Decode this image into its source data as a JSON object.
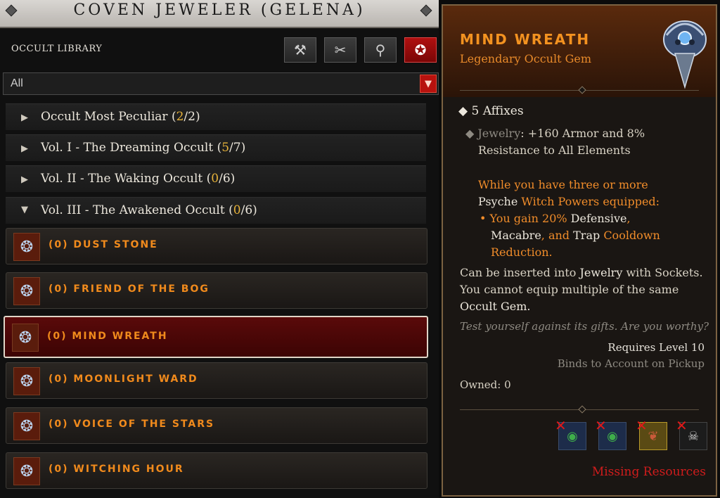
{
  "window": {
    "title": "COVEN JEWELER (GELENA)"
  },
  "library": {
    "label": "OCCULT LIBRARY",
    "tools": [
      {
        "icon": "hammer-icon",
        "glyph": "⚒"
      },
      {
        "icon": "tongs-icon",
        "glyph": "✂"
      },
      {
        "icon": "socket-ring-icon",
        "glyph": "⚲"
      },
      {
        "icon": "occult-gem-tab-icon",
        "glyph": "✪"
      }
    ],
    "filter": {
      "value": "All"
    }
  },
  "categories": [
    {
      "name": "Occult Most Peculiar",
      "open": "(",
      "count": "2",
      "slash": "/",
      "total": "2",
      "close": ")"
    },
    {
      "name": "Vol. I - The Dreaming Occult",
      "open": "(",
      "count": "5",
      "slash": "/",
      "total": "7",
      "close": ")"
    },
    {
      "name": "Vol. II - The Waking Occult",
      "open": "(",
      "count": "0",
      "slash": "/",
      "total": "6",
      "close": ")"
    },
    {
      "name": "Vol. III - The Awakened Occult",
      "open": "(",
      "count": "0",
      "slash": "/",
      "total": "6",
      "close": ")"
    }
  ],
  "gems": [
    {
      "label": "(0) DUST STONE"
    },
    {
      "label": "(0) FRIEND OF THE BOG"
    },
    {
      "label": "(0) MIND WREATH"
    },
    {
      "label": "(0) MOONLIGHT WARD"
    },
    {
      "label": "(0) VOICE OF THE STARS"
    },
    {
      "label": "(0) WITCHING HOUR"
    }
  ],
  "tooltip": {
    "name": "MIND WREATH",
    "type": "Legendary Occult Gem",
    "affixes": "5 Affixes",
    "jewelry_label": "Jewelry",
    "jewelry_stat_1": ": +160 Armor and 8%",
    "jewelry_stat_2": "Resistance to All Elements",
    "cond_1": "While you have three or more",
    "cond_2a": "Psyche ",
    "cond_2b": "Witch Powers equipped:",
    "eff_1a": "You gain 20% ",
    "eff_1b": "Defensive",
    "eff_1c": ",",
    "eff_2a": "Macabre",
    "eff_2b": ", and ",
    "eff_2c": "Trap ",
    "eff_2d": "Cooldown",
    "eff_3": "Reduction.",
    "ins_1a": "Can be inserted into ",
    "ins_1b": "Jewelry",
    "ins_1c": " with Sockets.",
    "ins_2": "You cannot equip multiple of the same",
    "ins_3": "Occult Gem.",
    "flavor": "Test yourself against its gifts. Are you worthy?",
    "requires": "Requires Level 10",
    "binds": "Binds to Account on Pickup",
    "owned": "Owned: 0",
    "materials": [
      {
        "icon": "green-gem-material-icon",
        "glyph": "◉",
        "color": "#3fae4a"
      },
      {
        "icon": "green-gem-material-icon",
        "glyph": "◉",
        "color": "#3fae4a"
      },
      {
        "icon": "heart-material-icon",
        "glyph": "❦",
        "color": "#c85a3a"
      },
      {
        "icon": "skull-material-icon",
        "glyph": "☠",
        "color": "#d0d0d0"
      }
    ],
    "missing": "Missing Resources"
  },
  "colors": {
    "accent_orange": "#f08c2a",
    "selected_row": "#5a0a0a",
    "missing_red": "#d01c1c",
    "count_gold": "#e6b23a"
  }
}
